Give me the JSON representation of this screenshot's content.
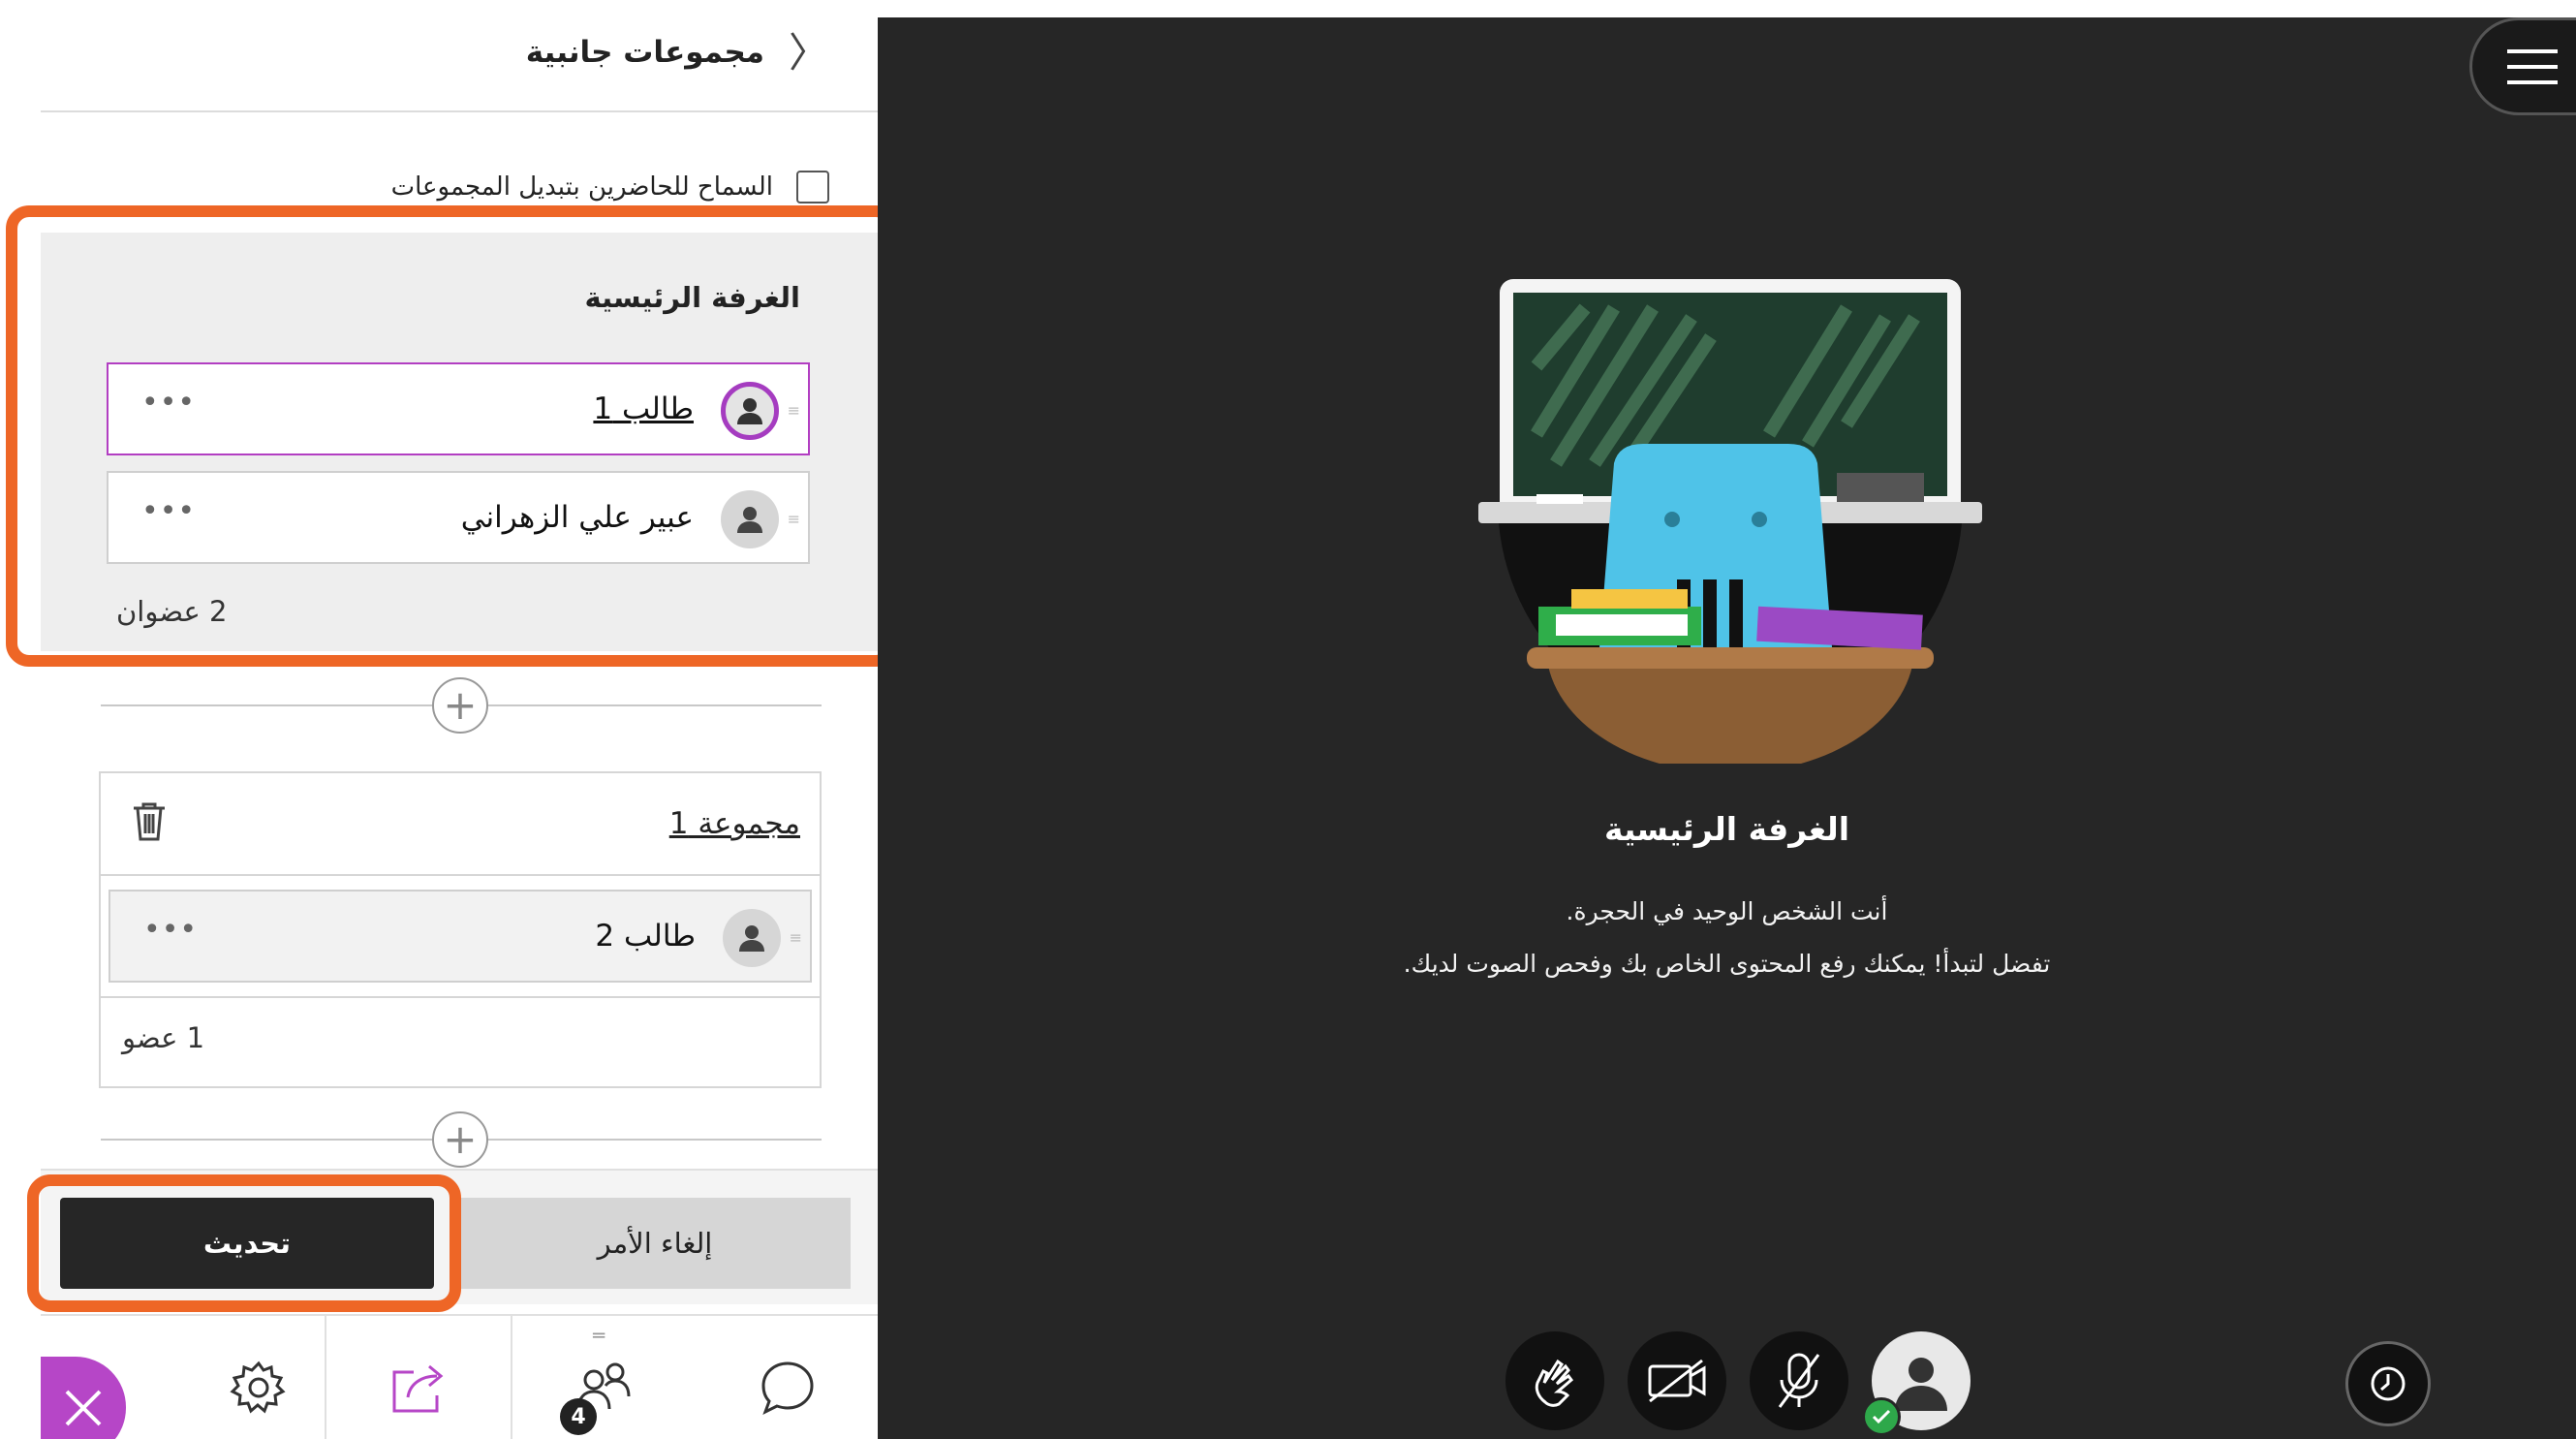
{
  "panel": {
    "title": "مجموعات جانبية",
    "allow_switch_label": "السماح للحاضرين بتبديل المجموعات",
    "allow_switch_checked": false
  },
  "main_room": {
    "title": "الغرفة الرئيسية",
    "members": [
      {
        "name": "طالب 1",
        "more": "•••"
      },
      {
        "name": "عبير علي الزهراني",
        "more": "•••"
      }
    ],
    "count": "2 عضوان"
  },
  "group1": {
    "name": "مجموعة 1",
    "members": [
      {
        "name": "طالب 2",
        "more": "•••"
      }
    ],
    "count": "1 عضو"
  },
  "buttons": {
    "update": "تحديث",
    "cancel": "إلغاء الأمر"
  },
  "tabs": {
    "attendees_badge": "4"
  },
  "stage": {
    "title": "الغرفة الرئيسية",
    "line1": "أنت الشخص الوحيد في الحجرة.",
    "line2": "تفضل لتبدأ! يمكنك رفع المحتوى الخاص بك وفحص الصوت لديك."
  },
  "colors": {
    "highlight": "#ee6626",
    "accent_purple": "#b646c7",
    "stage_bg": "#262626",
    "status_green": "#2ea84a"
  },
  "icons": [
    "chevron-right-icon",
    "user-icon",
    "trash-icon",
    "plus-icon",
    "close-icon",
    "gear-icon",
    "share-icon",
    "attendees-icon",
    "chat-icon",
    "hand-raise-icon",
    "camera-off-icon",
    "mic-off-icon",
    "check-icon",
    "menu-icon",
    "clock-icon"
  ]
}
